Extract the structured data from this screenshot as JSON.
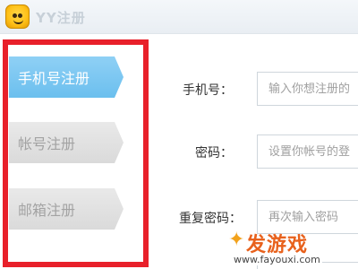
{
  "window": {
    "title": "YY注册",
    "logo": "yy-mascot-logo"
  },
  "sidebar": {
    "items": [
      {
        "label": "手机号注册",
        "active": true
      },
      {
        "label": "帐号注册",
        "active": false
      },
      {
        "label": "邮箱注册",
        "active": false
      }
    ],
    "highlight_color": "#e8202a",
    "active_color": "#6bbfee"
  },
  "form": {
    "phone": {
      "label": "手机号：",
      "placeholder": "输入你想注册的"
    },
    "password": {
      "label": "密码：",
      "placeholder": "设置你帐号的登"
    },
    "confirm": {
      "label": "重复密码：",
      "placeholder": "再次输入密码"
    }
  },
  "watermark": {
    "text": "发游戏",
    "url": "www.fayouxi.com"
  }
}
